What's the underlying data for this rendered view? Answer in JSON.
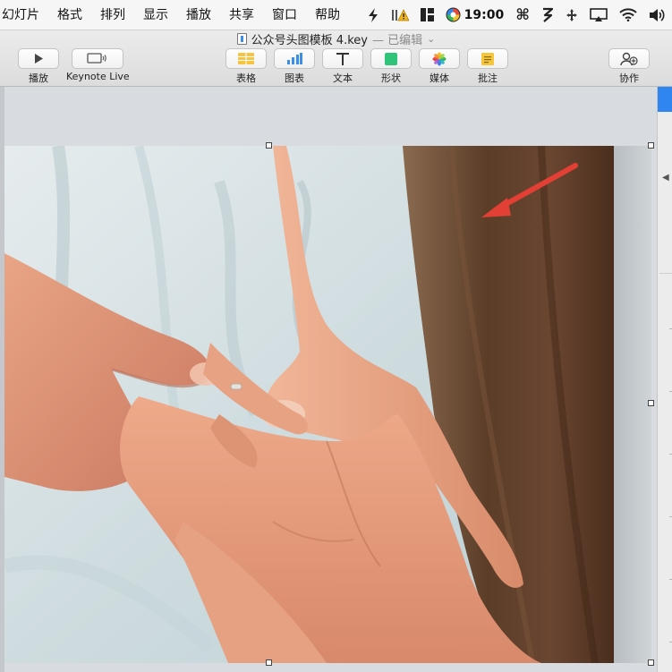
{
  "menubar": {
    "items": [
      "幻灯片",
      "格式",
      "排列",
      "显示",
      "播放",
      "共享",
      "窗口",
      "帮助"
    ],
    "clock": "19:00"
  },
  "window": {
    "document_title": "公众号头图模板 4.key",
    "edited_state": "— 已编辑",
    "chevron": "⌄"
  },
  "toolbar": {
    "play_label": "播放",
    "keynote_live_label": "Keynote Live",
    "table_label": "表格",
    "chart_label": "图表",
    "text_label": "文本",
    "shape_label": "形状",
    "media_label": "媒体",
    "comment_label": "批注",
    "collaborate_label": "协作"
  },
  "colors": {
    "table_icon": "#f6c445",
    "chart_icon": "#3b8fe5",
    "shape_icon": "#2fc47a",
    "comment_icon": "#f5c53a",
    "annotation_arrow": "#e23f35",
    "inspector_accent": "#2f86f0"
  },
  "slide": {
    "image_subject": "hands-photo"
  }
}
